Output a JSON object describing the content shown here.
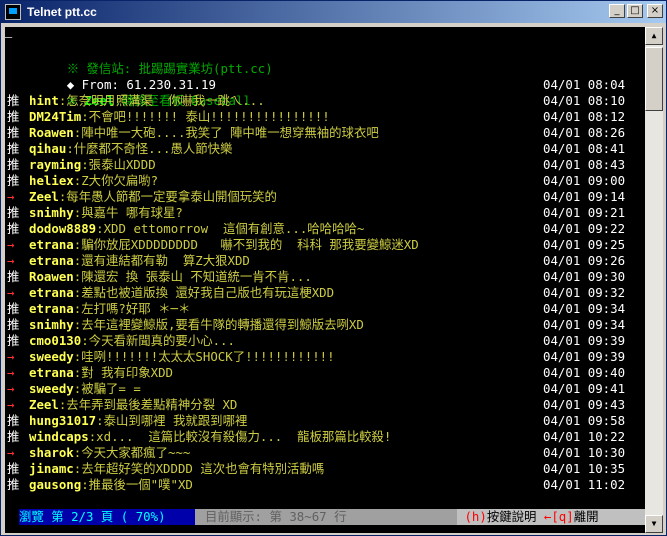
{
  "window": {
    "title": "Telnet ptt.cc",
    "buttons": {
      "minimize": "_",
      "maximize": "□",
      "close": "×"
    }
  },
  "terminal": {
    "cursor": "—",
    "header": {
      "site_mark": "※",
      "site_label": "發信站: 批踢踢實業坊(ptt.cc)",
      "from_mark": "◆",
      "from_label": "From: 61.230.31.19",
      "forward_mark": "※",
      "forward_user": "Zeel",
      "forward_text": ":轉錄至看板 Baseball",
      "forward_time": "04/01 08:04"
    },
    "comments": [
      {
        "tag": "推",
        "type": "push",
        "user": "hint",
        "text": ":怎奈明月照溝渠  你嚇我一跳ㄟ...",
        "time": "04/01 08:10"
      },
      {
        "tag": "推",
        "type": "push",
        "user": "DM24Tim",
        "text": ":不會吧!!!!!!! 泰山!!!!!!!!!!!!!!!!",
        "time": "04/01 08:12"
      },
      {
        "tag": "推",
        "type": "push",
        "user": "Roawen",
        "text": ":陣中唯一大砲....我笑了 陣中唯一想穿無袖的球衣吧",
        "time": "04/01 08:26"
      },
      {
        "tag": "推",
        "type": "push",
        "user": "qihau",
        "text": ":什麼都不奇怪...愚人節快樂",
        "time": "04/01 08:41"
      },
      {
        "tag": "推",
        "type": "push",
        "user": "rayming",
        "text": ":張泰山XDDD",
        "time": "04/01 08:43"
      },
      {
        "tag": "推",
        "type": "push",
        "user": "heliex",
        "text": ":Z大你欠扁喲?",
        "time": "04/01 09:00"
      },
      {
        "tag": "→",
        "type": "arrow",
        "user": "Zeel",
        "text": ":每年愚人節都一定要拿泰山開個玩笑的",
        "time": "04/01 09:14"
      },
      {
        "tag": "推",
        "type": "push",
        "user": "snimhy",
        "text": ":與嘉牛 哪有球星?",
        "time": "04/01 09:21"
      },
      {
        "tag": "推",
        "type": "push",
        "user": "dodow8889",
        "text": ":XDD ettomorrow  這個有創意...哈哈哈哈~",
        "time": "04/01 09:22"
      },
      {
        "tag": "→",
        "type": "arrow",
        "user": "etrana",
        "text": ":騙你放屁XDDDDDDDD   嚇不到我的  科科 那我要變鯨迷XD",
        "time": "04/01 09:25"
      },
      {
        "tag": "→",
        "type": "arrow",
        "user": "etrana",
        "text": ":還有連結都有勒  算Z大狠XDD",
        "time": "04/01 09:26"
      },
      {
        "tag": "推",
        "type": "push",
        "user": "Roawen",
        "text": ":陳還宏 換 張泰山 不知道統一肯不肯...",
        "time": "04/01 09:30"
      },
      {
        "tag": "→",
        "type": "arrow",
        "user": "etrana",
        "text": ":差點也被道版換 還好我自己版也有玩這梗XDD",
        "time": "04/01 09:32"
      },
      {
        "tag": "推",
        "type": "push",
        "user": "etrana",
        "text": ":左打嗎?好耶 ＊─＊",
        "time": "04/01 09:34"
      },
      {
        "tag": "推",
        "type": "push",
        "user": "snimhy",
        "text": ":去年這裡變鯨版,要看牛隊的轉播還得到鯨版去咧XD",
        "time": "04/01 09:34"
      },
      {
        "tag": "推",
        "type": "push",
        "user": "cmo0130",
        "text": ":今天看新聞真的要小心...",
        "time": "04/01 09:39"
      },
      {
        "tag": "→",
        "type": "arrow",
        "user": "sweedy",
        "text": ":哇咧!!!!!!!太太太SHOCK了!!!!!!!!!!!!",
        "time": "04/01 09:39"
      },
      {
        "tag": "→",
        "type": "arrow",
        "user": "etrana",
        "text": ":對 我有印象XDD",
        "time": "04/01 09:40"
      },
      {
        "tag": "→",
        "type": "arrow",
        "user": "sweedy",
        "text": ":被騙了= =",
        "time": "04/01 09:41"
      },
      {
        "tag": "→",
        "type": "arrow",
        "user": "Zeel",
        "text": ":去年弄到最後差點精神分裂 XD",
        "time": "04/01 09:43"
      },
      {
        "tag": "推",
        "type": "push",
        "user": "hung31017",
        "text": ":泰山到哪裡 我就跟到哪裡",
        "time": "04/01 09:58"
      },
      {
        "tag": "推",
        "type": "push",
        "user": "windcaps",
        "text": ":xd...  這篇比較沒有殺傷力...  龍板那篇比較殺!",
        "time": "04/01 10:22"
      },
      {
        "tag": "→",
        "type": "arrow",
        "user": "sharok",
        "text": ":今天大家都瘋了~~~",
        "time": "04/01 10:30"
      },
      {
        "tag": "推",
        "type": "push",
        "user": "jinamc",
        "text": ":去年超好笑的XDDDD 這次也會有特別活動嗎",
        "time": "04/01 10:35"
      },
      {
        "tag": "推",
        "type": "push",
        "user": "gausong",
        "text": ":推最後一個\"噗\"XD",
        "time": "04/01 11:02"
      }
    ],
    "status": {
      "browse": "瀏覽 第 2/3 頁 ( 70%)",
      "showing": "目前顯示: 第 38~67 行",
      "help_key": "(h)",
      "help_label": "按鍵說明",
      "leave_key": "←[q]",
      "leave_label": "離開"
    }
  },
  "scrollbar": {
    "up": "▲",
    "down": "▼"
  },
  "colors": {
    "background": "#000000",
    "push_tag": "#ffffff",
    "arrow_tag": "#ff3333",
    "user": "#ffff55",
    "comment": "#cccc44",
    "header": "#00aa00",
    "status_bg": "#0000aa"
  }
}
